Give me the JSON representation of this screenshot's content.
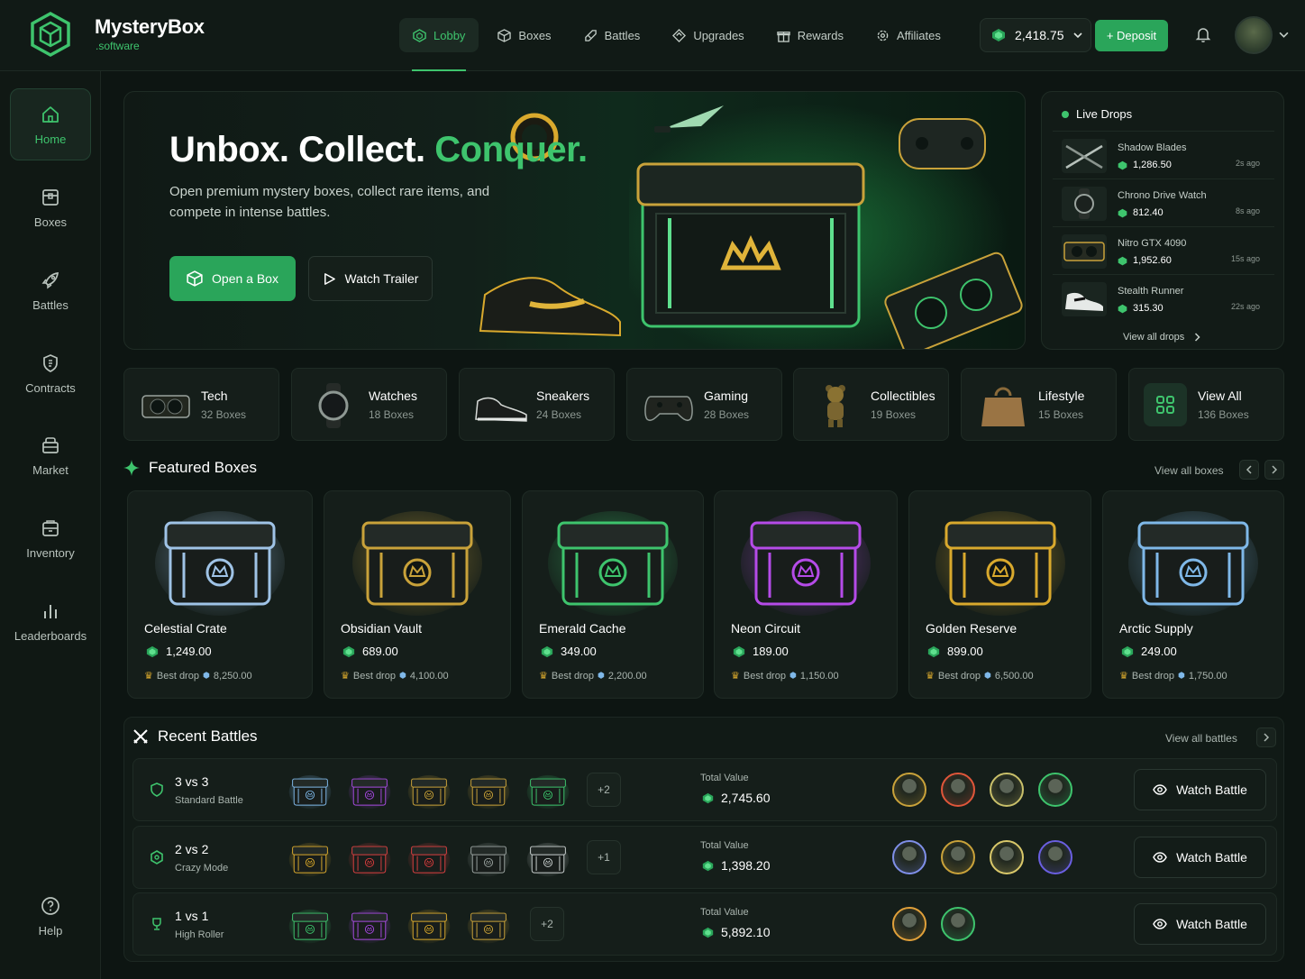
{
  "brand": {
    "name": "MysteryBox",
    "sub": ".software"
  },
  "nav": [
    {
      "label": "Lobby",
      "icon": "lobby-icon",
      "active": true
    },
    {
      "label": "Boxes",
      "icon": "box-icon"
    },
    {
      "label": "Battles",
      "icon": "battle-icon"
    },
    {
      "label": "Upgrades",
      "icon": "upgrade-icon"
    },
    {
      "label": "Rewards",
      "icon": "gift-icon"
    },
    {
      "label": "Affiliates",
      "icon": "affiliate-icon"
    }
  ],
  "header": {
    "balance": "2,418.75",
    "deposit_label": "+ Deposit"
  },
  "sidebar": [
    {
      "label": "Home",
      "icon": "home-icon"
    },
    {
      "label": "Boxes",
      "icon": "boxes-icon"
    },
    {
      "label": "Battles",
      "icon": "rocket-icon"
    },
    {
      "label": "Contracts",
      "icon": "contract-icon"
    },
    {
      "label": "Market",
      "icon": "market-icon"
    },
    {
      "label": "Inventory",
      "icon": "inventory-icon"
    },
    {
      "label": "Leaderboards",
      "icon": "leaderboard-icon"
    }
  ],
  "help_label": "Help",
  "hero": {
    "title_a": "Unbox. Collect.",
    "title_b": "Conquer.",
    "subtitle": "Open premium mystery boxes, collect rare items, and compete in intense battles.",
    "open_label": "Open a Box",
    "trailer_label": "Watch Trailer"
  },
  "live_drops": {
    "title": "Live Drops",
    "items": [
      {
        "name": "Shadow Blades",
        "price": "1,286.50",
        "time": "2s ago"
      },
      {
        "name": "Chrono Drive Watch",
        "price": "812.40",
        "time": "8s ago"
      },
      {
        "name": "Nitro GTX 4090",
        "price": "1,952.60",
        "time": "15s ago"
      },
      {
        "name": "Stealth Runner",
        "price": "315.30",
        "time": "22s ago"
      }
    ],
    "view_all": "View all drops"
  },
  "categories": [
    {
      "name": "Tech",
      "count": "32 Boxes"
    },
    {
      "name": "Watches",
      "count": "18 Boxes"
    },
    {
      "name": "Sneakers",
      "count": "24 Boxes"
    },
    {
      "name": "Gaming",
      "count": "28 Boxes"
    },
    {
      "name": "Collectibles",
      "count": "19 Boxes"
    },
    {
      "name": "Lifestyle",
      "count": "15 Boxes"
    },
    {
      "name": "View All",
      "count": "136 Boxes"
    }
  ],
  "featured": {
    "title": "Featured Boxes",
    "view_all": "View all boxes",
    "boxes": [
      {
        "name": "Celestial Crate",
        "price": "1,249.00",
        "best_label": "Best drop",
        "best": "8,250.00",
        "color": "#9fc3e6"
      },
      {
        "name": "Obsidian Vault",
        "price": "689.00",
        "best_label": "Best drop",
        "best": "4,100.00",
        "color": "#c9a23a"
      },
      {
        "name": "Emerald Cache",
        "price": "349.00",
        "best_label": "Best drop",
        "best": "2,200.00",
        "color": "#3ec46d"
      },
      {
        "name": "Neon Circuit",
        "price": "189.00",
        "best_label": "Best drop",
        "best": "1,150.00",
        "color": "#b54be8"
      },
      {
        "name": "Golden Reserve",
        "price": "899.00",
        "best_label": "Best drop",
        "best": "6,500.00",
        "color": "#d9a92d"
      },
      {
        "name": "Arctic Supply",
        "price": "249.00",
        "best_label": "Best drop",
        "best": "1,750.00",
        "color": "#7fb8e8"
      }
    ]
  },
  "battles": {
    "title": "Recent Battles",
    "view_all": "View all battles",
    "total_label": "Total Value",
    "watch_label": "Watch Battle",
    "rows": [
      {
        "mode": "3 vs 3",
        "type": "Standard Battle",
        "more": "+2",
        "total": "2,745.60",
        "boxes": [
          "#7fb8e8",
          "#a64be0",
          "#c9a23a",
          "#c9a23a",
          "#3ec46d"
        ],
        "players": [
          "#c9a23a",
          "#e0563a",
          "#c9c06a",
          "#3ec46d"
        ]
      },
      {
        "mode": "2 vs 2",
        "type": "Crazy Mode",
        "more": "+1",
        "total": "1,398.20",
        "boxes": [
          "#d9a92d",
          "#d94040",
          "#d94040",
          "#9aa3a0",
          "#c9d0cf"
        ],
        "players": [
          "#7f8fe8",
          "#c9a23a",
          "#d9c86a",
          "#6a5fe0"
        ]
      },
      {
        "mode": "1 vs 1",
        "type": "High Roller",
        "more": "+2",
        "total": "5,892.10",
        "boxes": [
          "#3ec46d",
          "#a64be0",
          "#d9a92d",
          "#c9a23a"
        ],
        "players": [
          "#e0a03a",
          "#3ec46d"
        ]
      }
    ]
  },
  "colors": {
    "accent": "#3ec46d",
    "bg": "#0d1512",
    "panel": "#151e1a"
  }
}
